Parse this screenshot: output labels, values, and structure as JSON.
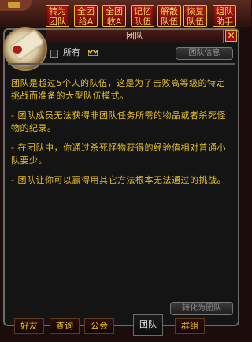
{
  "top_menu": [
    {
      "label": "转为团队"
    },
    {
      "label": "全团给A"
    },
    {
      "label": "全团收A"
    },
    {
      "label": "记忆队伍"
    },
    {
      "label": "解散队伍"
    },
    {
      "label": "恢复队伍"
    },
    {
      "label": "组队助手"
    }
  ],
  "window": {
    "title": "团队",
    "close_label": "✕"
  },
  "filter": {
    "label": "所有",
    "checked": false
  },
  "info_button": "团队信息",
  "content": [
    "团队是超过5个人的队伍，这是为了击败高等级的特定挑战而准备的大型队伍模式。",
    "- 团队成员无法获得非团队任务所需的物品或者杀死怪物的纪录。",
    "- 在团队中，你通过杀死怪物获得的经验值相对普通小队要少。",
    "- 团队让你可以赢得用其它方法根本无法通过的挑战。"
  ],
  "convert_button": "转化为团队",
  "tabs": [
    {
      "label": "好友"
    },
    {
      "label": "查询"
    },
    {
      "label": "公会"
    },
    {
      "label": "团队"
    },
    {
      "label": "群组"
    }
  ],
  "colors": {
    "accent_gold": "#e8c020",
    "button_red": "#b01a10"
  }
}
